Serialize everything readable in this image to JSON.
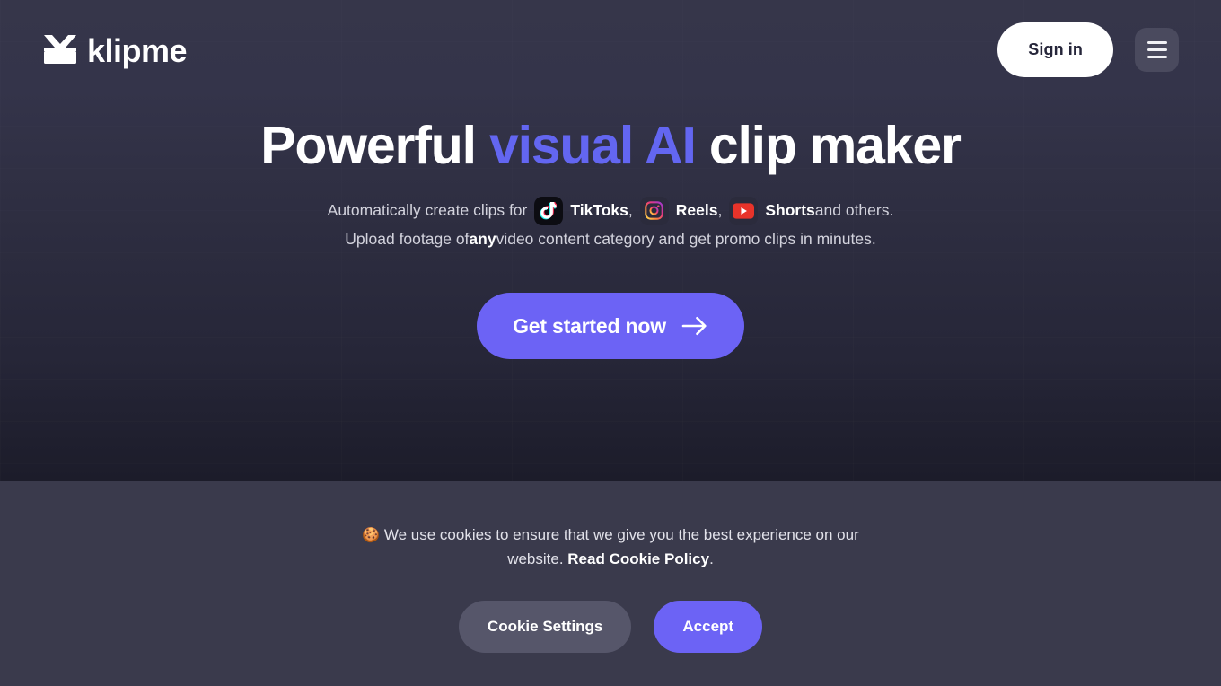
{
  "colors": {
    "accent_purple": "#6366f1",
    "button_purple": "#6c63f5",
    "hero_bg_top": "#36364a",
    "hero_bg_bottom": "#1c1c2a",
    "cookie_bg": "#3a3a4c",
    "text_muted": "#d3d3dd",
    "tiktok_chip_bg": "#0c0c12",
    "youtube_red": "#e8332a"
  },
  "header": {
    "logo_icon": "klipme-clip-mark-icon",
    "brand_name": "klipme",
    "sign_in_label": "Sign in",
    "menu_icon": "hamburger-menu-icon"
  },
  "hero": {
    "headline_part1": "Powerful ",
    "headline_accent": "visual AI",
    "headline_part2": " clip maker",
    "subtitle": {
      "line1_prefix": "Automatically create clips for",
      "tiktok_icon": "tiktok-icon",
      "tiktok_label": "TikToks",
      "comma1": ",",
      "instagram_icon": "instagram-icon",
      "reels_label": "Reels",
      "comma2": ",",
      "youtube_icon": "youtube-shorts-icon",
      "shorts_label": "Shorts",
      "line1_suffix": " and others.",
      "line2_prefix": "Upload footage of ",
      "line2_bold": "any",
      "line2_suffix": " video content category and get promo clips in minutes."
    },
    "cta_label": "Get started now",
    "cta_icon": "arrow-right-icon"
  },
  "cookie_banner": {
    "emoji": "🍪",
    "message_part1": " We use cookies to ensure that we give you the best experience on our website. ",
    "policy_link": "Read Cookie Policy",
    "message_part2": ".",
    "settings_label": "Cookie Settings",
    "accept_label": "Accept"
  }
}
